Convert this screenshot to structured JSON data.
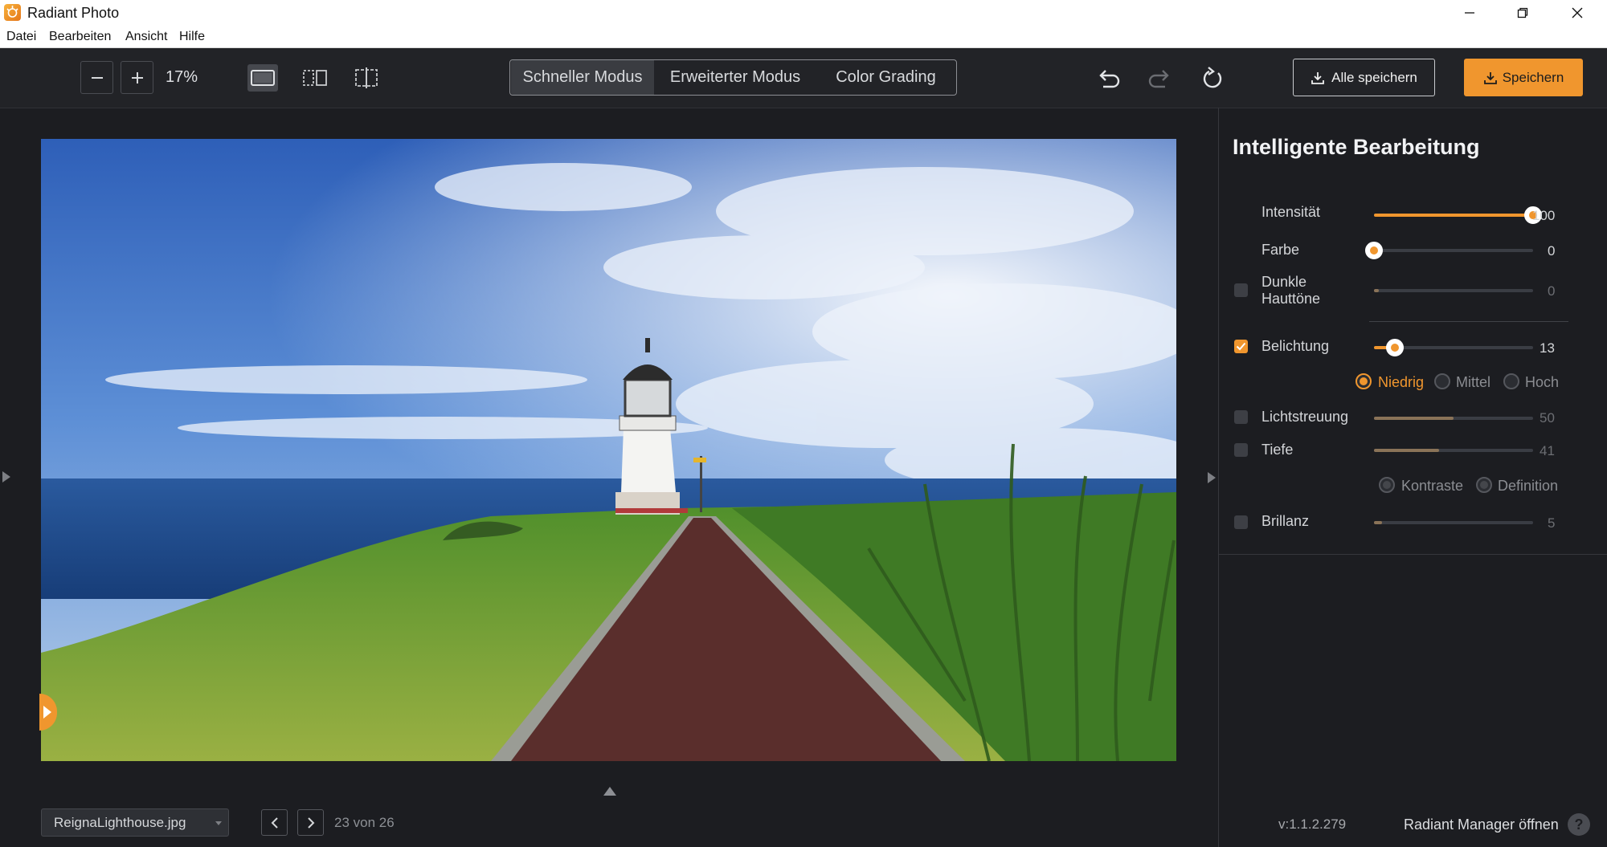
{
  "window": {
    "title": "Radiant Photo"
  },
  "menu": {
    "items": [
      "Datei",
      "Bearbeiten",
      "Ansicht",
      "Hilfe"
    ]
  },
  "toolbar": {
    "zoom": "17%",
    "modes": [
      "Schneller Modus",
      "Erweiterter Modus",
      "Color Grading"
    ],
    "active_mode": "Schneller Modus",
    "save_all_label": "Alle speichern",
    "save_label": "Speichern",
    "accent_color": "#f0962e"
  },
  "panel": {
    "title": "Intelligente Bearbeitung",
    "sliders": {
      "intensitaet": {
        "label": "Intensität",
        "value": "100",
        "level": 1.0
      },
      "farbe": {
        "label": "Farbe",
        "value": "0",
        "level": 0.0
      },
      "dunkle": {
        "label_line1": "Dunkle",
        "label_line2": "Hauttöne",
        "value": "0",
        "level": 0.0,
        "checked": false
      },
      "belichtung": {
        "label": "Belichtung",
        "value": "13",
        "level": 0.13,
        "checked": true
      },
      "lichtstreuung": {
        "label": "Lichtstreuung",
        "value": "50",
        "level": 0.5,
        "checked": false
      },
      "tiefe": {
        "label": "Tiefe",
        "value": "41",
        "level": 0.41,
        "checked": false
      },
      "brillanz": {
        "label": "Brillanz",
        "value": "5",
        "level": 0.05,
        "checked": false
      }
    },
    "exposure_levels": [
      "Niedrig",
      "Mittel",
      "Hoch"
    ],
    "exposure_selected": "Niedrig",
    "depth_options": [
      "Kontraste",
      "Definition"
    ]
  },
  "bottom": {
    "file_name": "ReignaLighthouse.jpg",
    "counter": "23 von 26",
    "version": "v:1.1.2.279",
    "manager_link": "Radiant Manager öffnen",
    "help": "?"
  },
  "image": {
    "description_icon": "lighthouse-photo"
  }
}
